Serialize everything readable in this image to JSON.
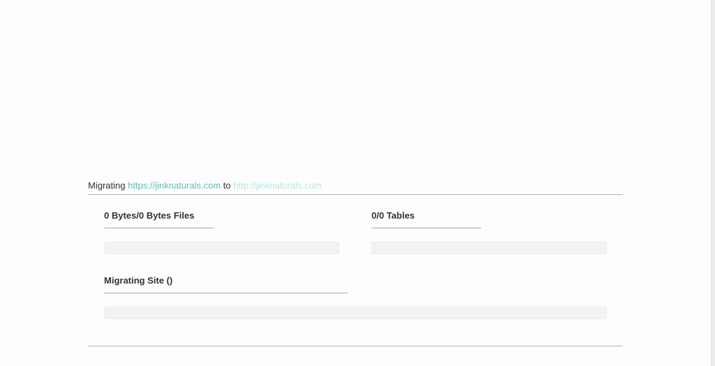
{
  "migration": {
    "prefix": "Migrating",
    "source_url": "https://jinknaturals.com",
    "connector": "to",
    "destination_url": "http://jinknaturals.com"
  },
  "files": {
    "label": "0 Bytes/0 Bytes Files",
    "progress_percent": 0
  },
  "tables": {
    "label": "0/0 Tables",
    "progress_percent": 0
  },
  "site": {
    "label": "Migrating Site ()",
    "progress_percent": 0
  },
  "colors": {
    "accent": "#2ea6a0",
    "bar_track": "#f3f3f3",
    "rule": "#b5b5b5"
  }
}
